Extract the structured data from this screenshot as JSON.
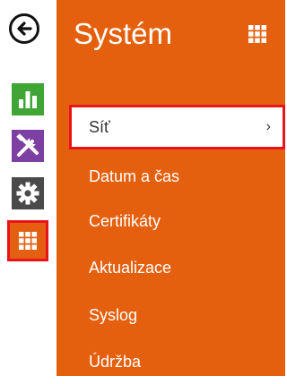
{
  "panel": {
    "title": "Systém"
  },
  "menu": {
    "items": [
      {
        "label": "Síť",
        "active": true
      },
      {
        "label": "Datum a čas",
        "active": false
      },
      {
        "label": "Certifikáty",
        "active": false
      },
      {
        "label": "Aktualizace",
        "active": false
      },
      {
        "label": "Syslog",
        "active": false
      },
      {
        "label": "Údržba",
        "active": false
      }
    ]
  },
  "rail": {
    "buttons": [
      {
        "icon": "back-arrow-icon"
      },
      {
        "icon": "bar-chart-icon",
        "color": "#3fa535"
      },
      {
        "icon": "tools-icon",
        "color": "#7e3fa3"
      },
      {
        "icon": "gear-icon",
        "color": "#4a4a4a"
      },
      {
        "icon": "grid-icon",
        "color": "#e55f12",
        "selected": true
      }
    ]
  },
  "colors": {
    "panel": "#e4600e",
    "highlight": "#e8141a"
  }
}
